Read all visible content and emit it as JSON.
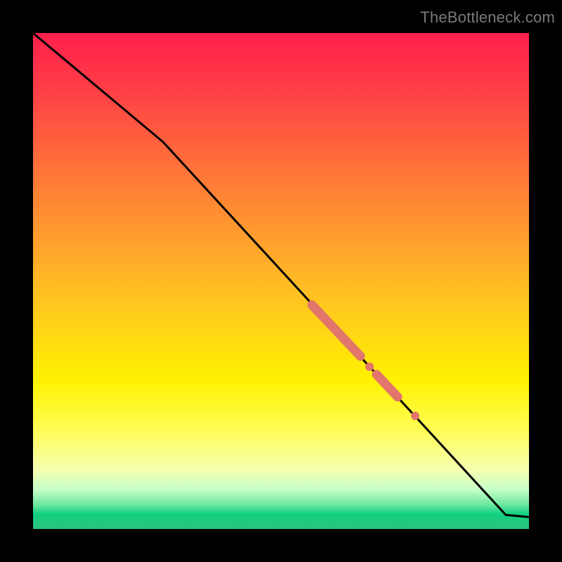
{
  "watermark": "TheBottleneck.com",
  "colors": {
    "page_bg": "#000000",
    "line": "#000000",
    "marker": "#e2766b",
    "gradient_top": "#ff1f4b",
    "gradient_mid": "#fff200",
    "gradient_bottom": "#2dc27e"
  },
  "chart_data": {
    "type": "line",
    "title": "",
    "xlabel": "",
    "ylabel": "",
    "xlim": [
      0,
      1
    ],
    "ylim": [
      0,
      1
    ],
    "grid": false,
    "legend": false,
    "note": "Axes are unlabeled; values are normalized pixel fractions read from the plot area (origin at bottom-left).",
    "series": [
      {
        "name": "curve",
        "x": [
          0.0,
          0.262,
          0.953,
          1.0
        ],
        "y": [
          1.0,
          0.78,
          0.028,
          0.024
        ]
      }
    ],
    "markers": [
      {
        "name": "highlight-segment-1",
        "shape": "thick-segment",
        "x": [
          0.563,
          0.66
        ],
        "y": [
          0.452,
          0.348
        ]
      },
      {
        "name": "highlight-dot-1",
        "shape": "dot",
        "x": 0.679,
        "y": 0.327
      },
      {
        "name": "highlight-segment-2",
        "shape": "thick-segment",
        "x": [
          0.692,
          0.735
        ],
        "y": [
          0.312,
          0.266
        ]
      },
      {
        "name": "highlight-dot-2",
        "shape": "dot",
        "x": 0.77,
        "y": 0.228
      }
    ]
  }
}
